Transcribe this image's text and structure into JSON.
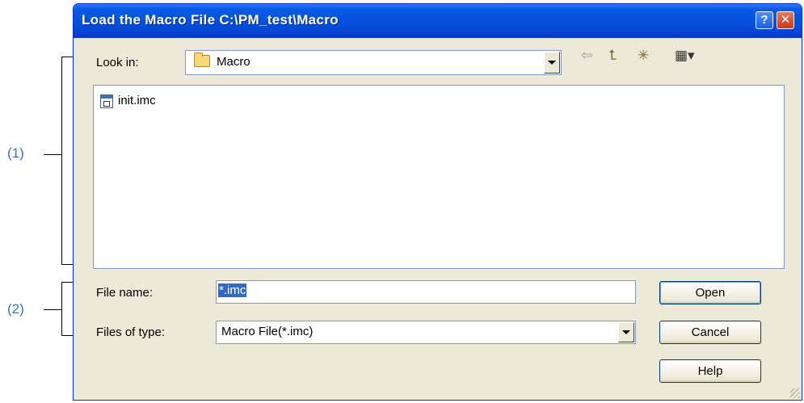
{
  "window": {
    "title": "Load the Macro File  C:\\PM_test\\Macro",
    "help_glyph": "?",
    "close_glyph": "✕"
  },
  "callouts": {
    "label1": "(1)",
    "label2": "(2)"
  },
  "look_in": {
    "label": "Look in:",
    "value": "Macro",
    "icon": "folder-icon"
  },
  "toolbar": {
    "back_icon": "back-arrow-icon",
    "back_glyph": "⇦",
    "up_icon": "up-one-level-icon",
    "up_glyph": "⮤",
    "new_folder_icon": "new-folder-icon",
    "new_folder_glyph": "✳",
    "view_menu_icon": "view-menu-icon",
    "view_menu_glyph": "▦▾"
  },
  "files": [
    {
      "name": "init.imc",
      "icon": "macro-file-icon"
    }
  ],
  "file_name": {
    "label": "File name:",
    "value": "*.imc"
  },
  "files_of_type": {
    "label": "Files of type:",
    "value": "Macro File(*.imc)"
  },
  "buttons": {
    "open": "Open",
    "cancel": "Cancel",
    "help": "Help"
  },
  "colors": {
    "title_bar": "#0553df",
    "dialog_bg": "#ece9d8",
    "callout": "#3a6fc4",
    "selection": "#316ac5"
  }
}
